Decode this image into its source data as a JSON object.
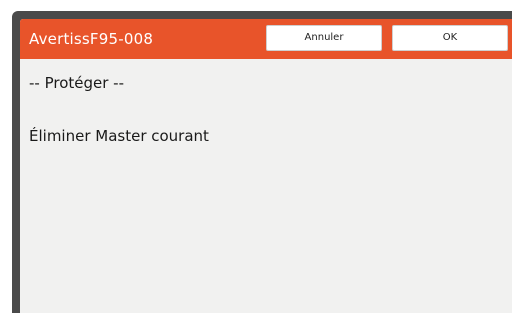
{
  "dialog": {
    "title": "AvertissF95-008",
    "buttons": {
      "cancel_label": "Annuler",
      "ok_label": "OK"
    },
    "message_header": "-- Protéger --",
    "message_body": "Éliminer Master courant"
  },
  "colors": {
    "header_accent": "#e8542a",
    "dialog_background": "#f1f1f0",
    "frame": "#4a4a4a"
  }
}
